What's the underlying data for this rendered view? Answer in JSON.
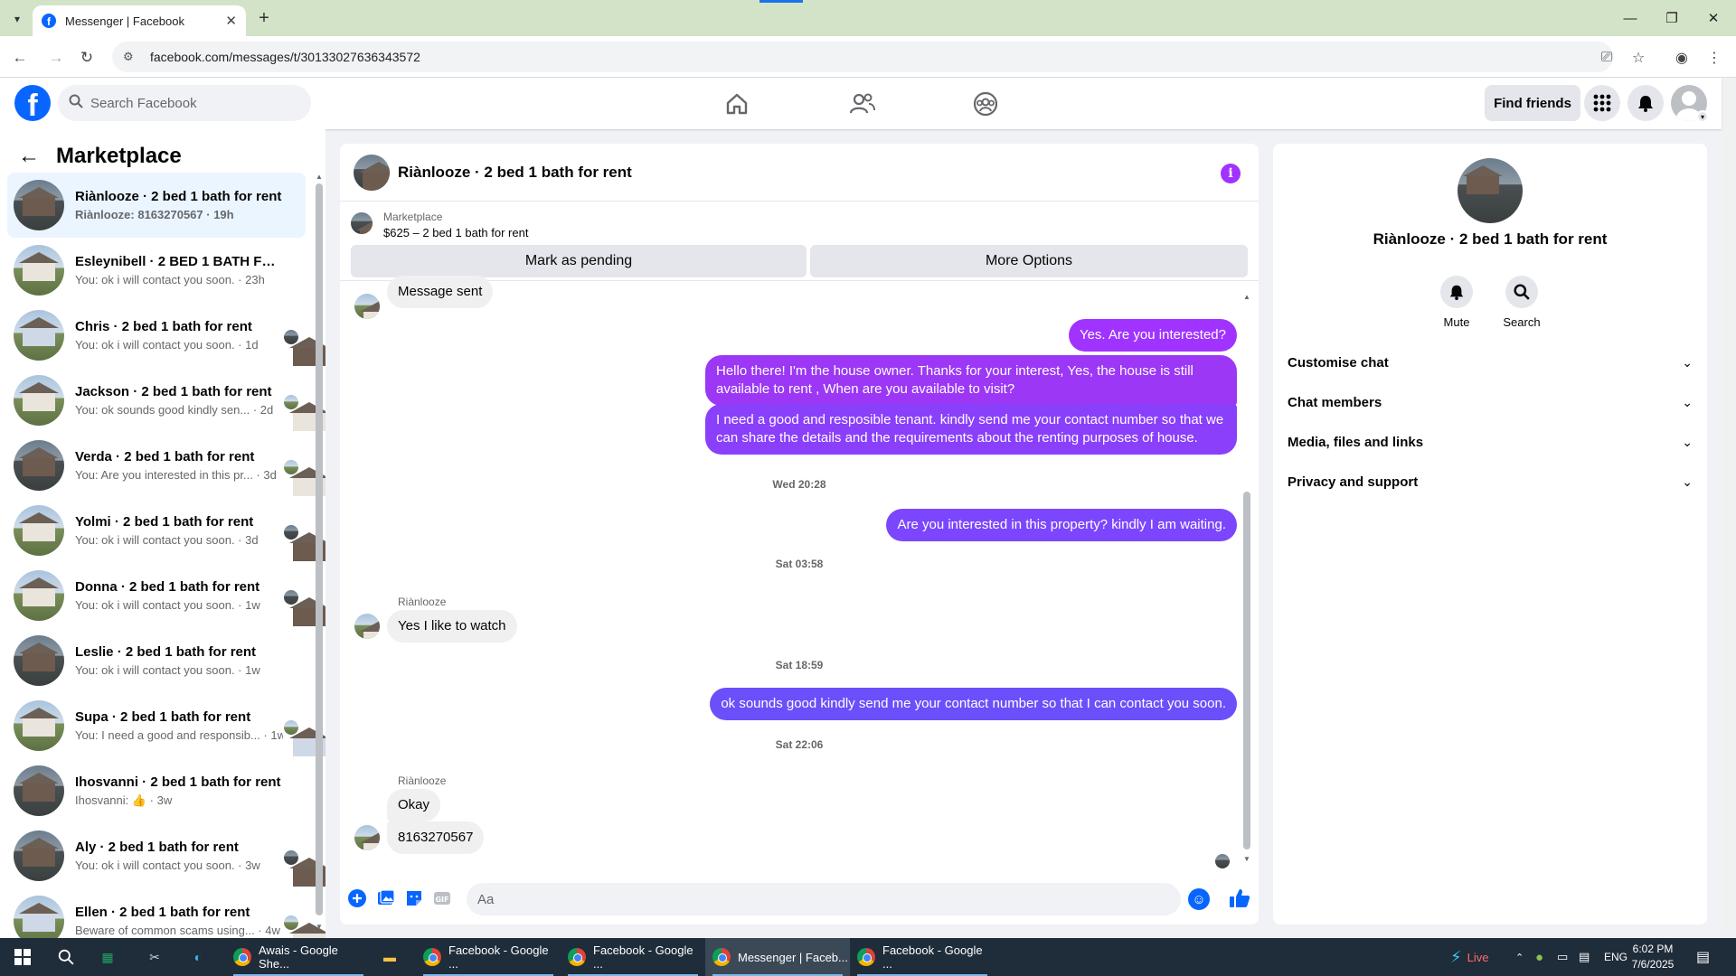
{
  "browser": {
    "tab_title": "Messenger | Facebook",
    "url": "facebook.com/messages/t/30133027636343572"
  },
  "header": {
    "search_placeholder": "Search Facebook",
    "find_friends": "Find friends"
  },
  "sidebar": {
    "title": "Marketplace",
    "items": [
      {
        "name": "Riànlooze · 2 bed 1 bath for rent",
        "preview": "Riànlooze: 8163270567 · 19h",
        "avatar": "dark",
        "active": true,
        "unread": true
      },
      {
        "name": "Esleynibell · 2 BED 1 BATH FOR R...",
        "preview": "You: ok i will contact you soon. · 23h",
        "avatar": "light"
      },
      {
        "name": "Chris · 2 bed 1 bath for rent",
        "preview": "You: ok i will contact you soon. · 1d",
        "avatar": "blue"
      },
      {
        "name": "Jackson · 2 bed 1 bath for rent",
        "preview": "You: ok sounds good kindly sen... · 2d",
        "avatar": "light"
      },
      {
        "name": "Verda · 2 bed 1 bath for rent",
        "preview": "You: Are you interested in this pr... · 3d",
        "avatar": "dark"
      },
      {
        "name": "Yolmi · 2 bed 1 bath for rent",
        "preview": "You: ok i will contact you soon. · 3d",
        "avatar": "light"
      },
      {
        "name": "Donna · 2 bed 1 bath for rent",
        "preview": "You: ok i will contact you soon. · 1w",
        "avatar": "light"
      },
      {
        "name": "Leslie · 2 bed 1 bath for rent",
        "preview": "You: ok i will contact you soon. · 1w",
        "avatar": "dark"
      },
      {
        "name": "Supa · 2 bed 1 bath for rent",
        "preview": "You: I need a good and responsib... · 1w",
        "avatar": "light"
      },
      {
        "name": "Ihosvanni · 2 bed 1 bath for rent",
        "preview": "Ihosvanni: 👍 · 3w",
        "avatar": "dark"
      },
      {
        "name": "Aly · 2 bed 1 bath for rent",
        "preview": "You: ok i will contact you soon. · 3w",
        "avatar": "dark"
      },
      {
        "name": "Ellen · 2 bed 1 bath for rent",
        "preview": "Beware of common scams using... · 4w",
        "avatar": "blue"
      }
    ]
  },
  "chat": {
    "title": "Riànlooze · 2 bed 1 bath for rent",
    "listing_label": "Marketplace",
    "listing_price": "$625 – 2 bed 1 bath for rent",
    "mark_pending": "Mark as pending",
    "more_options": "More Options",
    "messages": {
      "m0": "Message sent",
      "m1": "Yes. Are you interested?",
      "m2": "Hello there! I'm the house owner. Thanks for your interest, Yes, the house is still available to rent , When are you available to visit?",
      "m3": "I need a good and resposible tenant.  kindly send me your contact number so that we can share the details and the requirements about the renting purposes of house.",
      "t1": "Wed 20:28",
      "m4": "Are you interested in this property? kindly I am waiting.",
      "t2": "Sat 03:58",
      "sender1": "Riànlooze",
      "m5": "Yes I like to watch",
      "t3": "Sat 18:59",
      "m6": "ok sounds good kindly send me your contact number so that I can contact you soon.",
      "t4": "Sat 22:06",
      "sender2": "Riànlooze",
      "m7": "Okay",
      "m8": "8163270567"
    },
    "composer_placeholder": "Aa"
  },
  "info": {
    "name": "Riànlooze · 2 bed 1 bath for rent",
    "mute": "Mute",
    "search": "Search",
    "sections": [
      "Customise chat",
      "Chat members",
      "Media, files and links",
      "Privacy and support"
    ]
  },
  "taskbar": {
    "apps": [
      {
        "label": "Awais - Google She..."
      },
      {
        "label": "Facebook - Google ..."
      },
      {
        "label": "Facebook - Google ..."
      },
      {
        "label": "Messenger | Faceb..."
      },
      {
        "label": "Facebook - Google ..."
      }
    ],
    "live": "Live",
    "lang": "ENG",
    "time": "6:02 PM",
    "date": "7/6/2025"
  },
  "colors": {
    "accent_purple": "#a033ff",
    "accent_violet": "#6b4ffb",
    "facebook_blue": "#0866ff"
  }
}
